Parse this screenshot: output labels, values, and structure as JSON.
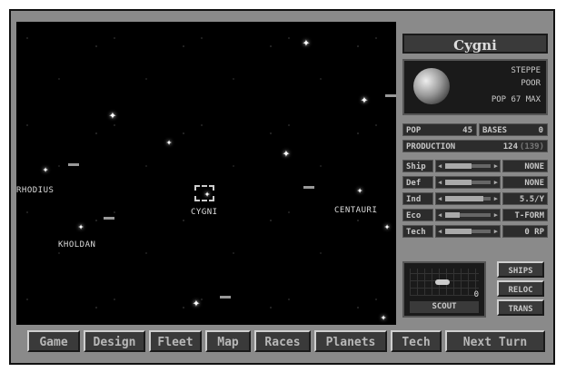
{
  "system": {
    "name": "Cygni",
    "planet_type": "STEPPE",
    "planet_quality": "POOR",
    "pop_line": "POP 67 MAX"
  },
  "stats": {
    "pop_label": "POP",
    "pop_value": "45",
    "bases_label": "BASES",
    "bases_value": "0",
    "production_label": "PRODUCTION",
    "production_value": "124",
    "production_extra": "(139)"
  },
  "sliders": [
    {
      "label": "Ship",
      "value": "NONE",
      "level": 0.55
    },
    {
      "label": "Def",
      "value": "NONE",
      "level": 0.55
    },
    {
      "label": "Ind",
      "value": "5.5/Y",
      "level": 0.8
    },
    {
      "label": "Eco",
      "value": "T-FORM",
      "level": 0.3
    },
    {
      "label": "Tech",
      "value": "0 RP",
      "level": 0.55
    }
  ],
  "ship_panel": {
    "name": "SCOUT",
    "count": "0"
  },
  "side_buttons": [
    "SHIPS",
    "RELOC",
    "TRANS"
  ],
  "map_labels": {
    "rhodius": "RHODIUS",
    "cygni": "CYGNI",
    "centauri": "CENTAURI",
    "kholdan": "KHOLDAN"
  },
  "menu": [
    "Game",
    "Design",
    "Fleet",
    "Map",
    "Races",
    "Planets",
    "Tech",
    "Next Turn"
  ],
  "colors": {
    "panel": "#8a8a8a",
    "button": "#3a3a3a",
    "text": "#c8c8c8"
  }
}
